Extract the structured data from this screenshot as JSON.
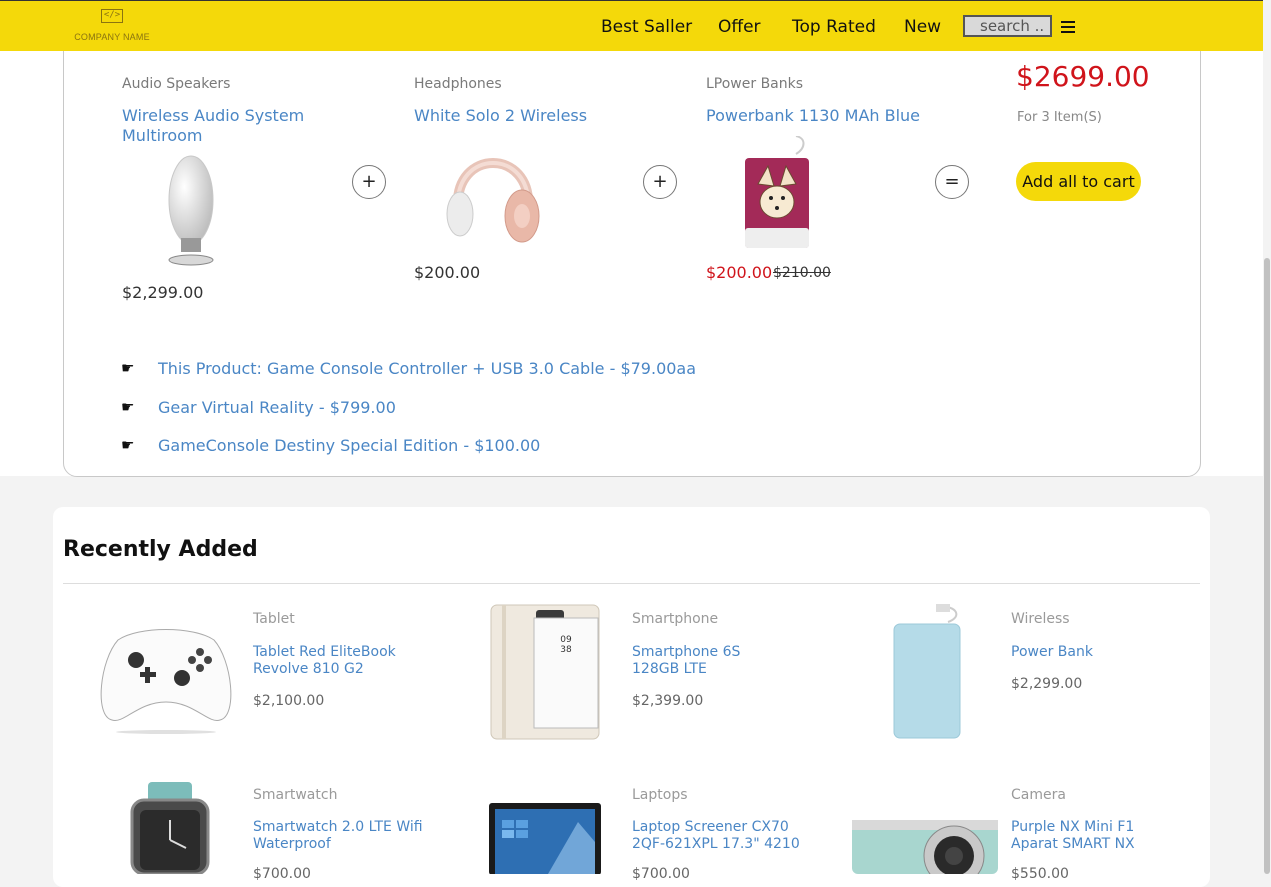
{
  "header": {
    "logo_text": "COMPANY NAME",
    "logo_mark": "</>",
    "nav": [
      "Best Saller",
      "Offer",
      "Top Rated",
      "New"
    ],
    "search_placeholder": "search .."
  },
  "bundle": {
    "items": [
      {
        "category": "Audio Speakers",
        "title": "Wireless Audio System Multiroom",
        "price": "$2,299.00",
        "icon": "speaker-image"
      },
      {
        "category": "Headphones",
        "title": "White Solo 2 Wireless",
        "price": "$200.00",
        "icon": "headphones-image"
      },
      {
        "category": "LPower Banks",
        "title": "Powerbank 1130 MAh Blue",
        "price": "$200.00",
        "old_price": "$210.00",
        "icon": "powerbank-image"
      }
    ],
    "operators": [
      "+",
      "+",
      "="
    ],
    "total": "$2699.00",
    "for_items": "For 3 Item(S)",
    "add_all_label": "Add all to cart",
    "links": [
      "This Product: Game Console Controller + USB 3.0 Cable - $79.00aa",
      "Gear Virtual Reality - $799.00",
      "GameConsole Destiny Special Edition - $100.00"
    ],
    "bullet_glyph": "☛"
  },
  "recent": {
    "heading": "Recently Added",
    "products": [
      {
        "category": "Tablet",
        "title": "Tablet Red EliteBook Revolve 810 G2",
        "price": "$2,100.00",
        "icon": "gamepad-image"
      },
      {
        "category": "Smartphone",
        "title": "Smartphone 6S 128GB LTE",
        "price": "$2,399.00",
        "icon": "smartphone-image"
      },
      {
        "category": "Wireless",
        "title": "Power Bank",
        "price": "$2,299.00",
        "icon": "powerbank-blue-image"
      },
      {
        "category": "Smartwatch",
        "title": "Smartwatch 2.0 LTE Wifi Waterproof",
        "price": "$700.00",
        "icon": "smartwatch-image"
      },
      {
        "category": "Laptops",
        "title": "Laptop Screener CX70 2QF-621XPL 17.3\" 4210",
        "price": "$700.00",
        "icon": "laptop-image"
      },
      {
        "category": "Camera",
        "title": "Purple NX Mini F1 Aparat SMART NX",
        "price": "$550.00",
        "icon": "camera-image"
      }
    ]
  },
  "colors": {
    "accent": "#f4d90a",
    "link": "#4a86c5",
    "sale": "#d0141b"
  }
}
